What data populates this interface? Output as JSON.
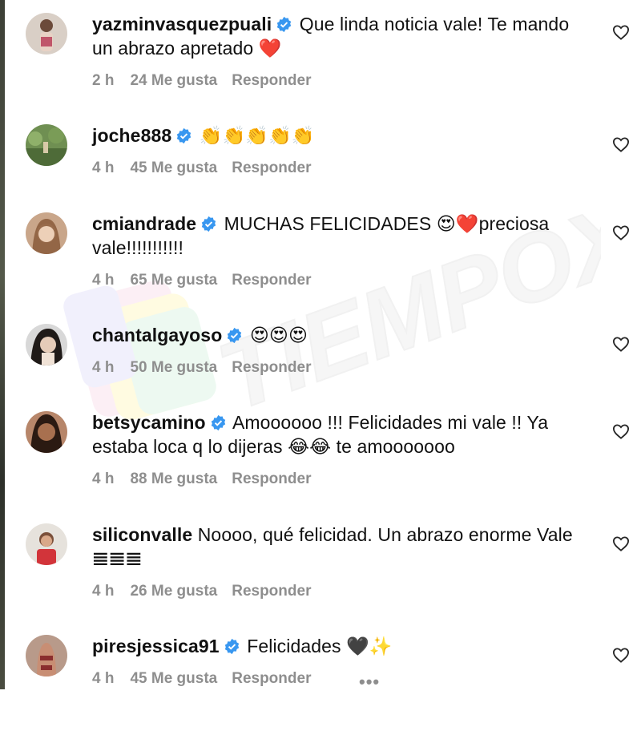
{
  "watermark_text": "TIEMPOX",
  "comments": [
    {
      "username": "yazminvasquezpuali",
      "verified": true,
      "text": "Que linda noticia vale! Te mando un abrazo apretado ❤️",
      "time": "2 h",
      "likes": "24 Me gusta",
      "reply": "Responder"
    },
    {
      "username": "joche888",
      "verified": true,
      "text": "👏👏👏👏👏",
      "time": "4 h",
      "likes": "45 Me gusta",
      "reply": "Responder"
    },
    {
      "username": "cmiandrade",
      "verified": true,
      "text": "MUCHAS FELICIDADES 😍❤️preciosa vale!!!!!!!!!!!",
      "time": "4 h",
      "likes": "65 Me gusta",
      "reply": "Responder"
    },
    {
      "username": "chantalgayoso",
      "verified": true,
      "text": "😍😍😍",
      "time": "4 h",
      "likes": "50 Me gusta",
      "reply": "Responder"
    },
    {
      "username": "betsycamino",
      "verified": true,
      "text": "Amoooooo !!! Felicidades mi vale !! Ya estaba loca q lo dijeras 😂😂 te amooooooo",
      "time": "4 h",
      "likes": "88 Me gusta",
      "reply": "Responder"
    },
    {
      "username": "siliconvalle",
      "verified": false,
      "text": "Noooo, qué felicidad. Un abrazo enorme Vale 𝌆𝌆𝌆",
      "time": "4 h",
      "likes": "26 Me gusta",
      "reply": "Responder"
    },
    {
      "username": "piresjessica91",
      "verified": true,
      "text": "Felicidades 🖤✨",
      "time": "4 h",
      "likes": "45 Me gusta",
      "reply": "Responder"
    }
  ],
  "more_options": "•••",
  "colors": {
    "verified_blue": "#3897f0",
    "meta_gray": "#8e8e8e",
    "heart_red": "#e0245e"
  }
}
